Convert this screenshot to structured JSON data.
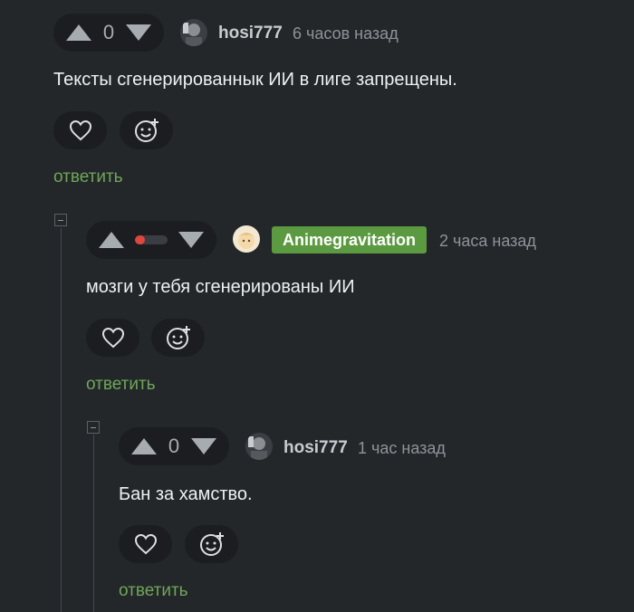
{
  "comments": [
    {
      "score": "0",
      "author": "hosi777",
      "time": "6 часов назад",
      "text": "Тексты сгенерированнык ИИ в лиге запрещены.",
      "reply_label": "ответить"
    },
    {
      "author": "Animegravitation",
      "time": "2 часа назад",
      "text": "мозги у тебя сгенерированы ИИ",
      "reply_label": "ответить",
      "rating_fraction": 0.3
    },
    {
      "score": "0",
      "author": "hosi777",
      "time": "1 час назад",
      "text": "Бан за хамство.",
      "reply_label": "ответить"
    }
  ],
  "colors": {
    "background": "#24272a",
    "pill": "#1b1d20",
    "reply": "#6ea65a",
    "badge": "#5c9a42",
    "negative": "#e0463d"
  },
  "icons": [
    "arrow-up-icon",
    "arrow-down-icon",
    "heart-icon",
    "add-reaction-icon",
    "collapse-icon"
  ]
}
